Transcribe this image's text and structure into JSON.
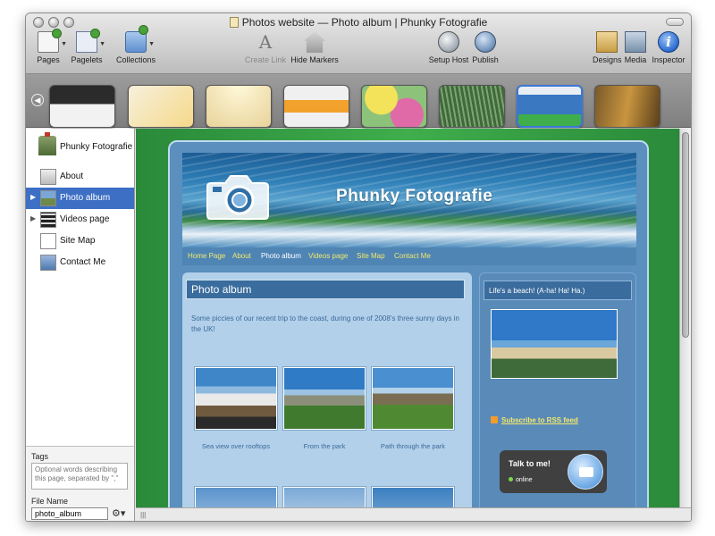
{
  "window": {
    "title": "Photos website — Photo album | Phunky Fotografie"
  },
  "toolbar": {
    "pages": "Pages",
    "pagelets": "Pagelets",
    "collections": "Collections",
    "create_link": "Create Link",
    "hide_markers": "Hide Markers",
    "setup_host": "Setup Host",
    "publish": "Publish",
    "designs": "Designs",
    "media": "Media",
    "inspector": "Inspector"
  },
  "sidebar": {
    "site_name": "Phunky Fotografie",
    "items": [
      {
        "label": "About",
        "selected": false,
        "disclosure": false,
        "icon": "page-icon"
      },
      {
        "label": "Photo album",
        "selected": true,
        "disclosure": true,
        "icon": "photo-album-icon"
      },
      {
        "label": "Videos page",
        "selected": false,
        "disclosure": true,
        "icon": "film-icon"
      },
      {
        "label": "Site Map",
        "selected": false,
        "disclosure": false,
        "icon": "sitemap-icon"
      },
      {
        "label": "Contact Me",
        "selected": false,
        "disclosure": false,
        "icon": "contact-icon"
      }
    ],
    "tags_label": "Tags",
    "tags_placeholder": "Optional words describing this page, separated by \",\"",
    "file_name_label": "File Name",
    "file_name_value": "photo_album"
  },
  "preview": {
    "banner_title": "Phunky Fotografie",
    "nav": [
      "Home Page",
      "About",
      "Photo album",
      "Videos page",
      "Site Map",
      "Contact Me"
    ],
    "nav_current": "Photo album",
    "main_title": "Photo album",
    "intro": "Some piccies of our recent trip to the coast, during one of 2008's three sunny days in the UK!",
    "captions": [
      "Sea view over rooftops",
      "From the park",
      "Path through the park"
    ],
    "side_title": "Life's a beach! (A-ha! Ha! Ha.)",
    "rss": "Subscribe to RSS feed",
    "talk": "Talk to me!",
    "online": "online"
  },
  "colors": {
    "accent": "#3d6fc4",
    "canvas_green": "#3fae4c",
    "nav_link": "#f2e86a",
    "page_blue": "#5a8fbe"
  }
}
